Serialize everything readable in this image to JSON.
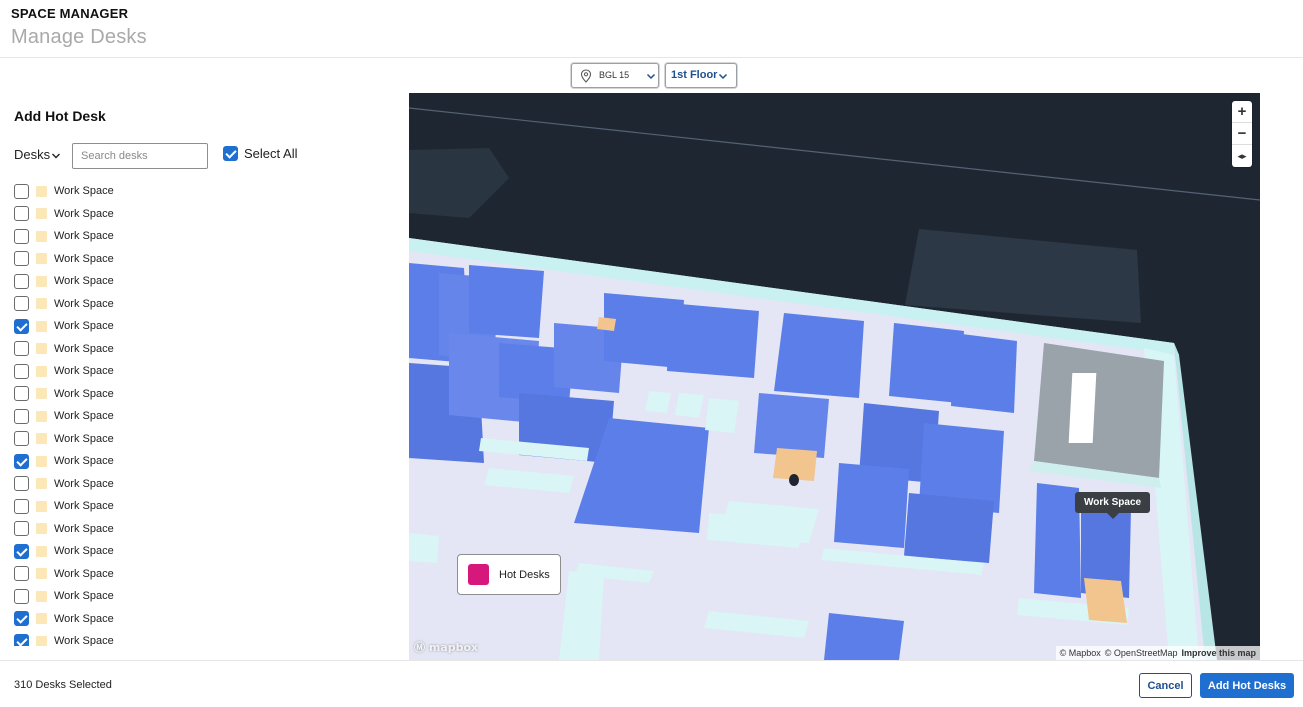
{
  "header": {
    "app_title": "SPACE MANAGER",
    "page_title": "Manage Desks"
  },
  "toolbar": {
    "building": {
      "value": "BGL 15",
      "icon": "location-pin-icon"
    },
    "floor": {
      "value": "1st Floor"
    }
  },
  "panel": {
    "title": "Add Hot Desk",
    "filter_label": "Desks",
    "search_placeholder": "Search desks",
    "select_all_label": "Select All",
    "select_all_checked": true,
    "desk_items": [
      {
        "label": "Work Space",
        "checked": false
      },
      {
        "label": "Work Space",
        "checked": false
      },
      {
        "label": "Work Space",
        "checked": false
      },
      {
        "label": "Work Space",
        "checked": false
      },
      {
        "label": "Work Space",
        "checked": false
      },
      {
        "label": "Work Space",
        "checked": false
      },
      {
        "label": "Work Space",
        "checked": true
      },
      {
        "label": "Work Space",
        "checked": false
      },
      {
        "label": "Work Space",
        "checked": false
      },
      {
        "label": "Work Space",
        "checked": false
      },
      {
        "label": "Work Space",
        "checked": false
      },
      {
        "label": "Work Space",
        "checked": false
      },
      {
        "label": "Work Space",
        "checked": true
      },
      {
        "label": "Work Space",
        "checked": false
      },
      {
        "label": "Work Space",
        "checked": false
      },
      {
        "label": "Work Space",
        "checked": false
      },
      {
        "label": "Work Space",
        "checked": true
      },
      {
        "label": "Work Space",
        "checked": false
      },
      {
        "label": "Work Space",
        "checked": false
      },
      {
        "label": "Work Space",
        "checked": true
      },
      {
        "label": "Work Space",
        "checked": true
      }
    ],
    "swatch_color": "#fbe7b8"
  },
  "map": {
    "zoom_in": "+",
    "zoom_out": "−",
    "compass": "◂▸",
    "tooltip": "Work Space",
    "legend_label": "Hot Desks",
    "legend_color": "#d6187c",
    "logo": "mapbox",
    "attribution": {
      "mapbox": "© Mapbox",
      "osm": "© OpenStreetMap",
      "improve": "Improve this map"
    },
    "colors": {
      "desk": "#5b7ee8",
      "floor": "#e4e6f5",
      "wall": "#c9f1f1",
      "background": "#1e2731"
    }
  },
  "footer": {
    "selected_count": "310 Desks Selected",
    "cancel_label": "Cancel",
    "add_label": "Add Hot Desks"
  }
}
